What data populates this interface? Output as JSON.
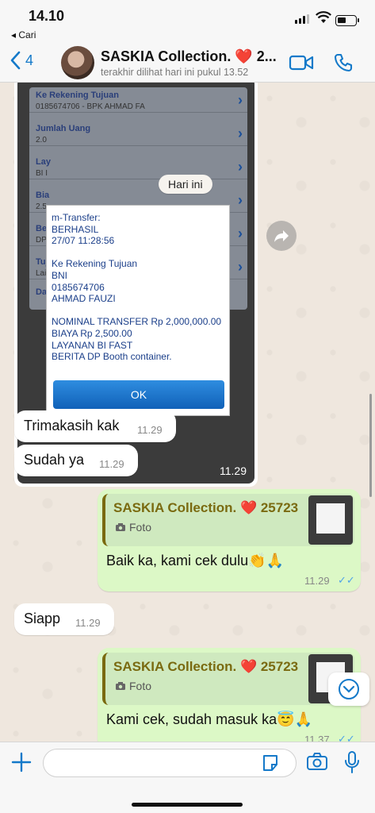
{
  "status": {
    "time": "14.10",
    "back_app": "Cari"
  },
  "header": {
    "unread_count": "4",
    "title": "SASKIA Collection. ❤️ 2...",
    "subtitle": "terakhir dilihat hari ini pukul 13.52"
  },
  "image_message": {
    "date_chip": "Hari ini",
    "time": "11.29",
    "background_rows": [
      {
        "label": "Ke Rekening Tujuan",
        "value": "0185674706 - BPK AHMAD  FA"
      },
      {
        "label": "Jumlah Uang",
        "value": "2.0"
      },
      {
        "label": "Lay",
        "value": "BI I"
      },
      {
        "label": "Bia",
        "value": "2.5"
      },
      {
        "label": "Ber",
        "value": "DP"
      },
      {
        "label": "Tuj",
        "value": "Lai"
      },
      {
        "label": "Dar",
        "value": ""
      }
    ],
    "dialog_text": "m-Transfer:\nBERHASIL\n27/07 11:28:56\n\nKe Rekening Tujuan\nBNI\n0185674706\nAHMAD FAUZI\n\nNOMINAL TRANSFER Rp 2,000,000.00\nBIAYA Rp 2,500.00\nLAYANAN BI FAST\nBERITA DP Booth container.",
    "ok_label": "OK"
  },
  "messages": [
    {
      "type": "in",
      "text": "Trimakasih kak",
      "time": "11.29"
    },
    {
      "type": "in",
      "text": "Sudah ya",
      "time": "11.29"
    },
    {
      "type": "out",
      "quote_name": "SASKIA Collection. ❤️ 25723",
      "quote_type": "Foto",
      "text": "Baik ka, kami cek dulu👏🙏",
      "time": "11.29",
      "ticks": "✓✓"
    },
    {
      "type": "in",
      "text": "Siapp",
      "time": "11.29"
    },
    {
      "type": "out",
      "quote_name": "SASKIA Collection. ❤️ 25723",
      "quote_type": "Foto",
      "text": "Kami cek, sudah masuk ka😇🙏",
      "time": "11.37",
      "ticks": "✓✓"
    }
  ]
}
